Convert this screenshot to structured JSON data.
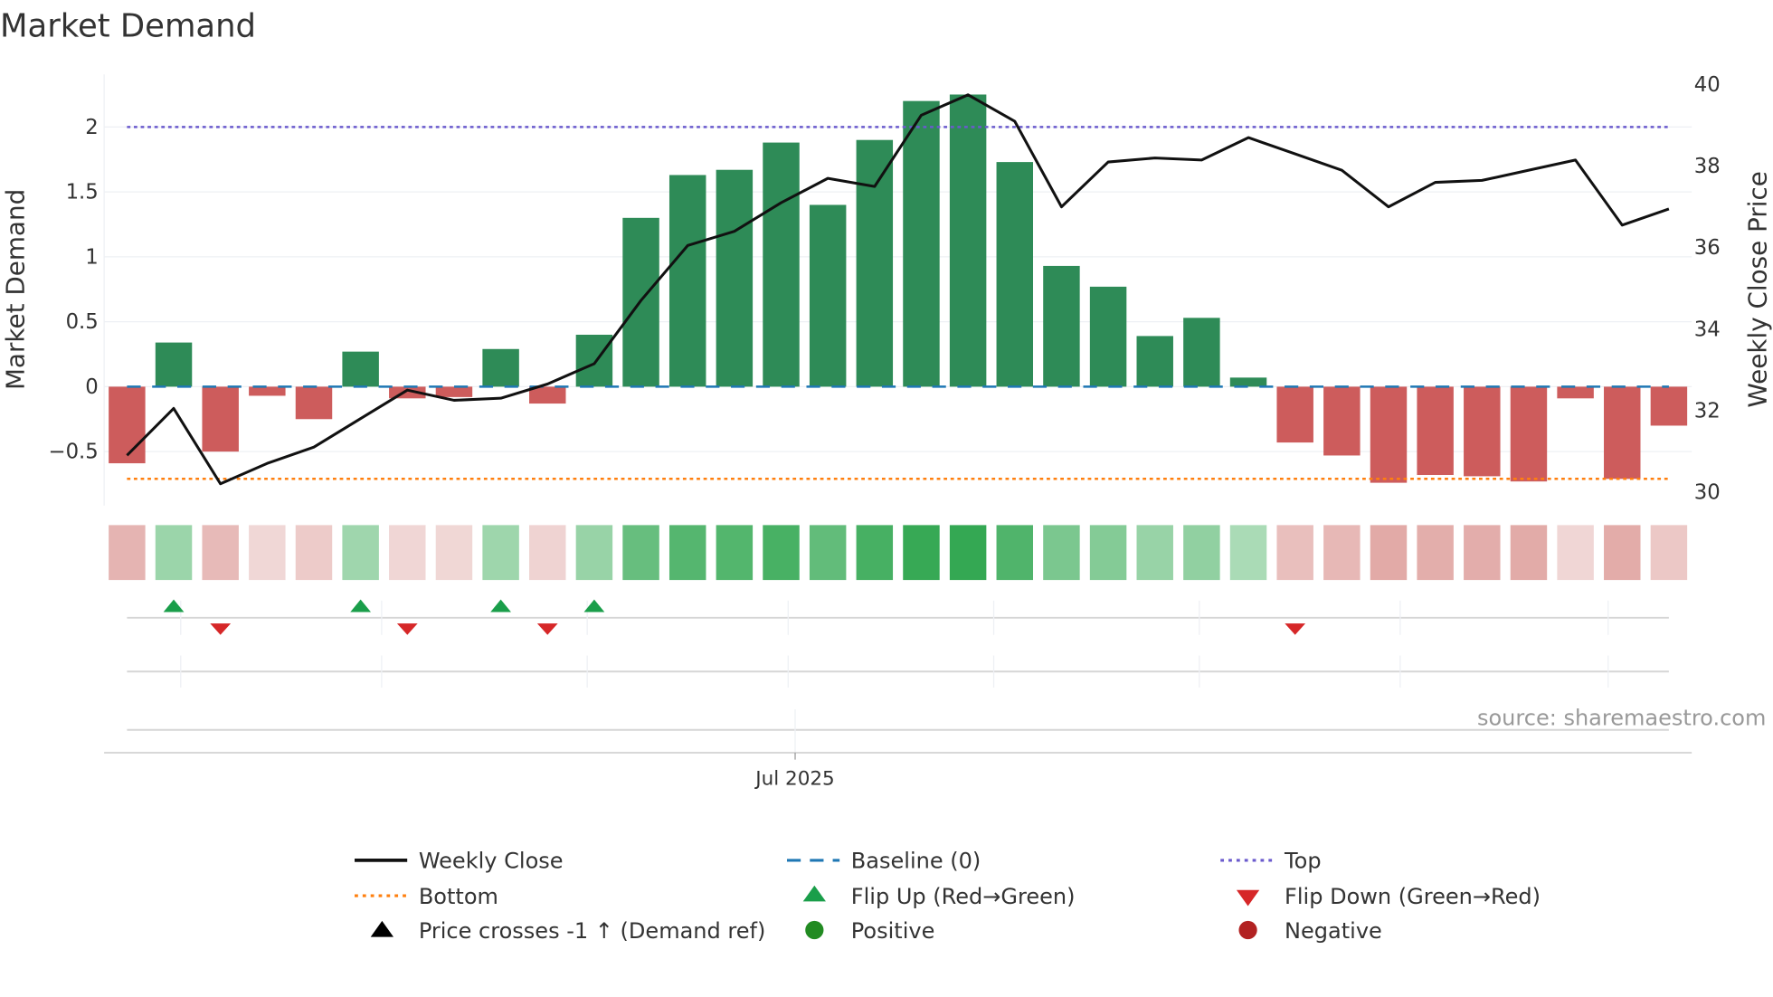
{
  "title": "Market Demand",
  "source": "source: sharemaestro.com",
  "colors": {
    "positive_bar": "#2e8b57",
    "negative_bar": "#cd5c5c",
    "price_line": "#111111",
    "baseline": "#1f77b4",
    "top": "#6a5acd",
    "bottom": "#ff7f0e",
    "flip_up": "#1a9e4a",
    "flip_down": "#d62728",
    "positive_dot": "#228b22",
    "negative_dot": "#b22222"
  },
  "chart_data": {
    "type": "bar",
    "title": "Market Demand",
    "ylabel": "Market Demand",
    "y2label": "Weekly Close Price",
    "ylim": [
      -0.85,
      2.4
    ],
    "y2lim": [
      30,
      40
    ],
    "yticks": [
      "−0.5",
      "0",
      "0.5",
      "1",
      "1.5",
      "2"
    ],
    "ytick_values": [
      -0.5,
      0,
      0.5,
      1,
      1.5,
      2
    ],
    "y2ticks": [
      "30",
      "32",
      "34",
      "36",
      "38",
      "40"
    ],
    "y2tick_values": [
      30,
      32,
      34,
      36,
      38,
      40
    ],
    "xticks": [
      "Jul 2025"
    ],
    "weeks": 34,
    "xtick_week_index": 15.3,
    "month_grid_week_index": [
      2.15,
      6.45,
      10.85,
      15.15,
      19.55,
      23.95,
      28.25,
      32.7
    ],
    "top": 2.0,
    "bottom": -0.71,
    "baseline": 0,
    "series": [
      {
        "name": "Market Demand",
        "axis": "left",
        "values": [
          -0.59,
          0.34,
          -0.5,
          -0.07,
          -0.25,
          0.27,
          -0.09,
          -0.08,
          0.29,
          -0.13,
          0.4,
          1.3,
          1.63,
          1.67,
          1.88,
          1.4,
          1.9,
          2.2,
          2.25,
          1.73,
          0.93,
          0.77,
          0.39,
          0.53,
          0.07,
          -0.43,
          -0.53,
          -0.74,
          -0.68,
          -0.69,
          -0.73,
          -0.09,
          -0.71,
          -0.3
        ]
      },
      {
        "name": "Weekly Close",
        "axis": "right",
        "values": [
          30.9,
          32.05,
          30.2,
          30.7,
          31.1,
          31.8,
          32.5,
          32.25,
          32.3,
          32.65,
          33.15,
          34.7,
          36.05,
          36.4,
          37.1,
          37.7,
          37.5,
          39.25,
          39.75,
          39.1,
          37.0,
          38.1,
          38.2,
          38.15,
          38.7,
          38.3,
          37.9,
          37.0,
          37.6,
          37.65,
          37.9,
          38.15,
          36.55,
          36.95
        ]
      }
    ],
    "flip_up_weeks": [
      2,
      6,
      9,
      11
    ],
    "flip_down_weeks": [
      3,
      7,
      10,
      26
    ],
    "legend": [
      {
        "label": "Weekly Close",
        "symbol": "solid-line"
      },
      {
        "label": "Baseline (0)",
        "symbol": "dashed-line"
      },
      {
        "label": "Top",
        "symbol": "dotted-line"
      },
      {
        "label": "Bottom",
        "symbol": "dotted-line"
      },
      {
        "label": "Flip Up (Red→Green)",
        "symbol": "triangle-up"
      },
      {
        "label": "Flip Down (Green→Red)",
        "symbol": "triangle-down"
      },
      {
        "label": "Price crosses -1 ↑ (Demand ref)",
        "symbol": "triangle-up-black"
      },
      {
        "label": "Positive",
        "symbol": "circle-green"
      },
      {
        "label": "Negative",
        "symbol": "circle-red"
      }
    ],
    "legend_position": "bottom"
  }
}
